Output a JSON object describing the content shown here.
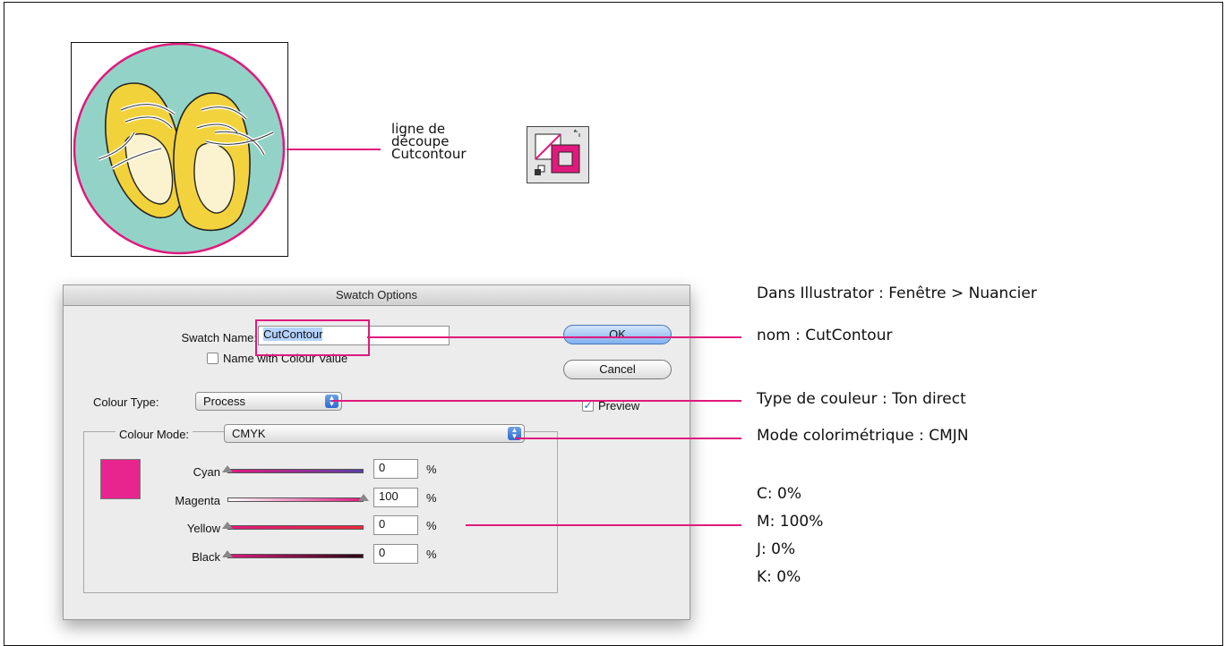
{
  "callout": {
    "line1": "ligne de",
    "line2": "découpe",
    "line3": "Cutcontour"
  },
  "dialog": {
    "title": "Swatch Options",
    "swatch_name_label": "Swatch Name:",
    "swatch_name_value": "CutContour",
    "name_with_colour_value": "Name with Colour Value",
    "colour_type_label": "Colour Type:",
    "colour_type_value": "Process",
    "colour_mode_label": "Colour Mode:",
    "colour_mode_value": "CMYK",
    "ok": "OK",
    "cancel": "Cancel",
    "preview": "Preview",
    "preview_checked": true,
    "channels": [
      {
        "name": "Cyan",
        "value": "0"
      },
      {
        "name": "Magenta",
        "value": "100"
      },
      {
        "name": "Yellow",
        "value": "0"
      },
      {
        "name": "Black",
        "value": "0"
      }
    ],
    "percent": "%",
    "swatch_color": "#e8248f"
  },
  "notes": {
    "menu": "Dans Illustrator : Fenêtre > Nuancier",
    "name": "nom : CutContour",
    "type": "Type de couleur : Ton direct",
    "mode": "Mode colorimétrique : CMJN",
    "c": "C: 0%",
    "m": "M: 100%",
    "j": "J: 0%",
    "k": "K: 0%"
  },
  "accent_color": "#e0197e"
}
